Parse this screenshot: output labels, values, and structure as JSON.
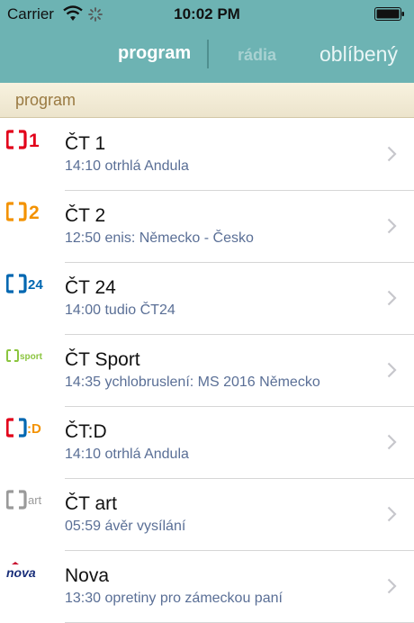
{
  "status": {
    "carrier": "Carrier",
    "time": "10:02 PM"
  },
  "tabs": {
    "program": "program",
    "radia": "rádia",
    "oblibeny": "oblíbený"
  },
  "section": {
    "title": "program"
  },
  "channels": [
    {
      "logo": "ct1-logo",
      "name": "ČT 1",
      "info": "14:10 otrhlá Andula",
      "color": "#e2001a"
    },
    {
      "logo": "ct2-logo",
      "name": "ČT 2",
      "info": "12:50 enis: Německo - Česko",
      "color": "#f39200"
    },
    {
      "logo": "ct24-logo",
      "name": "ČT 24",
      "info": "14:00 tudio ČT24",
      "color": "#0067b1"
    },
    {
      "logo": "ctsport-logo",
      "name": "ČT Sport",
      "info": "14:35 ychlobruslení: MS 2016 Německo",
      "color": "#8bc53f"
    },
    {
      "logo": "ctd-logo",
      "name": "ČT:D",
      "info": "14:10 otrhlá Andula",
      "color": "#e2001a"
    },
    {
      "logo": "ctart-logo",
      "name": "ČT art",
      "info": "05:59 ávěr vysílání",
      "color": "#9a9a9a"
    },
    {
      "logo": "nova-logo",
      "name": "Nova",
      "info": "13:30 opretiny pro zámeckou paní",
      "color": "#c8102e"
    }
  ]
}
